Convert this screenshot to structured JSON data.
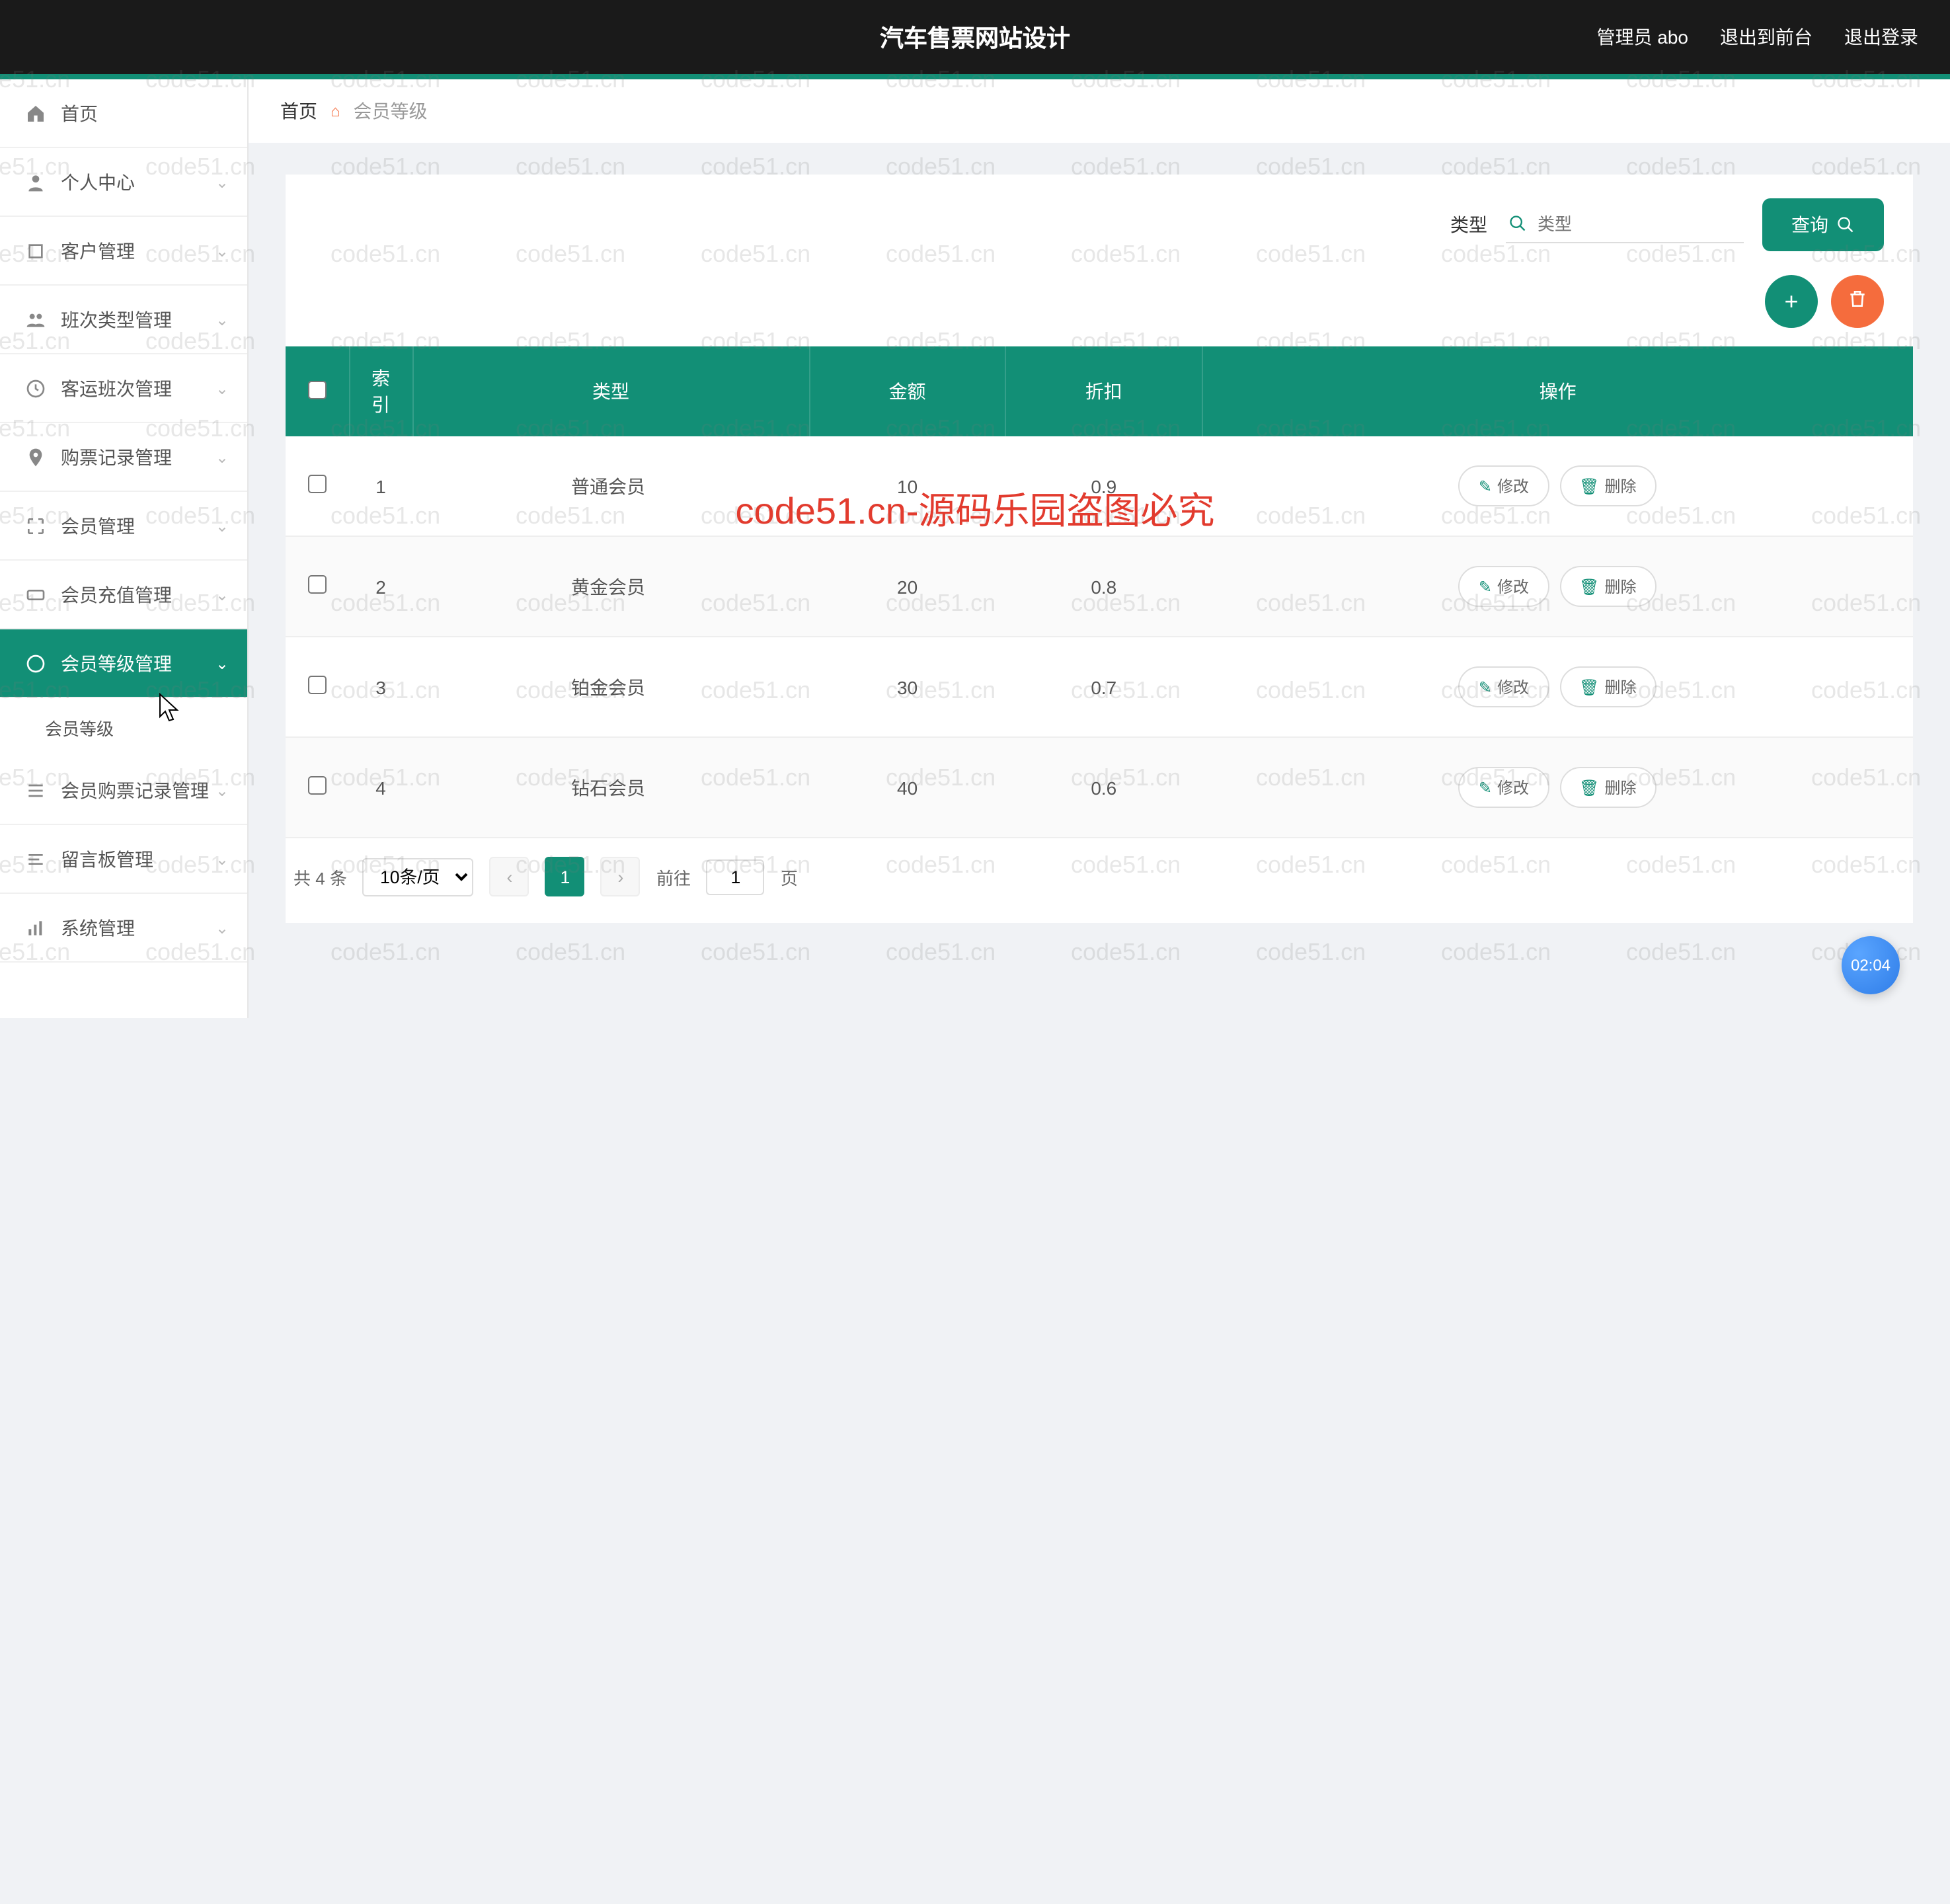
{
  "header": {
    "title": "汽车售票网站设计",
    "admin_label": "管理员 abo",
    "exit_front": "退出到前台",
    "logout": "退出登录"
  },
  "sidebar": {
    "items": [
      {
        "label": "首页",
        "icon": "home",
        "expandable": false
      },
      {
        "label": "个人中心",
        "icon": "user",
        "expandable": true
      },
      {
        "label": "客户管理",
        "icon": "crop",
        "expandable": true
      },
      {
        "label": "班次类型管理",
        "icon": "group",
        "expandable": true
      },
      {
        "label": "客运班次管理",
        "icon": "clock",
        "expandable": true
      },
      {
        "label": "购票记录管理",
        "icon": "pin",
        "expandable": true
      },
      {
        "label": "会员管理",
        "icon": "expand",
        "expandable": true
      },
      {
        "label": "会员充值管理",
        "icon": "ticket",
        "expandable": true
      },
      {
        "label": "会员等级管理",
        "icon": "star",
        "expandable": true,
        "active": true,
        "sub": "会员等级"
      },
      {
        "label": "会员购票记录管理",
        "icon": "list",
        "expandable": true
      },
      {
        "label": "留言板管理",
        "icon": "menu",
        "expandable": true
      },
      {
        "label": "系统管理",
        "icon": "bars",
        "expandable": true
      }
    ]
  },
  "breadcrumb": {
    "home": "首页",
    "current": "会员等级"
  },
  "search": {
    "label_left": "类型",
    "placeholder": "类型",
    "button": "查询"
  },
  "table": {
    "headers": [
      "",
      "索引",
      "类型",
      "金额",
      "折扣",
      "操作"
    ],
    "rows": [
      {
        "idx": "1",
        "type": "普通会员",
        "amount": "10",
        "discount": "0.9"
      },
      {
        "idx": "2",
        "type": "黄金会员",
        "amount": "20",
        "discount": "0.8"
      },
      {
        "idx": "3",
        "type": "铂金会员",
        "amount": "30",
        "discount": "0.7"
      },
      {
        "idx": "4",
        "type": "钻石会员",
        "amount": "40",
        "discount": "0.6"
      }
    ],
    "row_actions": {
      "edit": "修改",
      "delete": "删除"
    }
  },
  "pagination": {
    "total_text": "共 4 条",
    "page_size": "10条/页",
    "current_page": "1",
    "jump_prefix": "前往",
    "jump_suffix": "页",
    "jump_value": "1"
  },
  "watermark": {
    "text": "code51.cn",
    "center": "code51.cn-源码乐园盗图必究"
  },
  "timer": "02:04"
}
